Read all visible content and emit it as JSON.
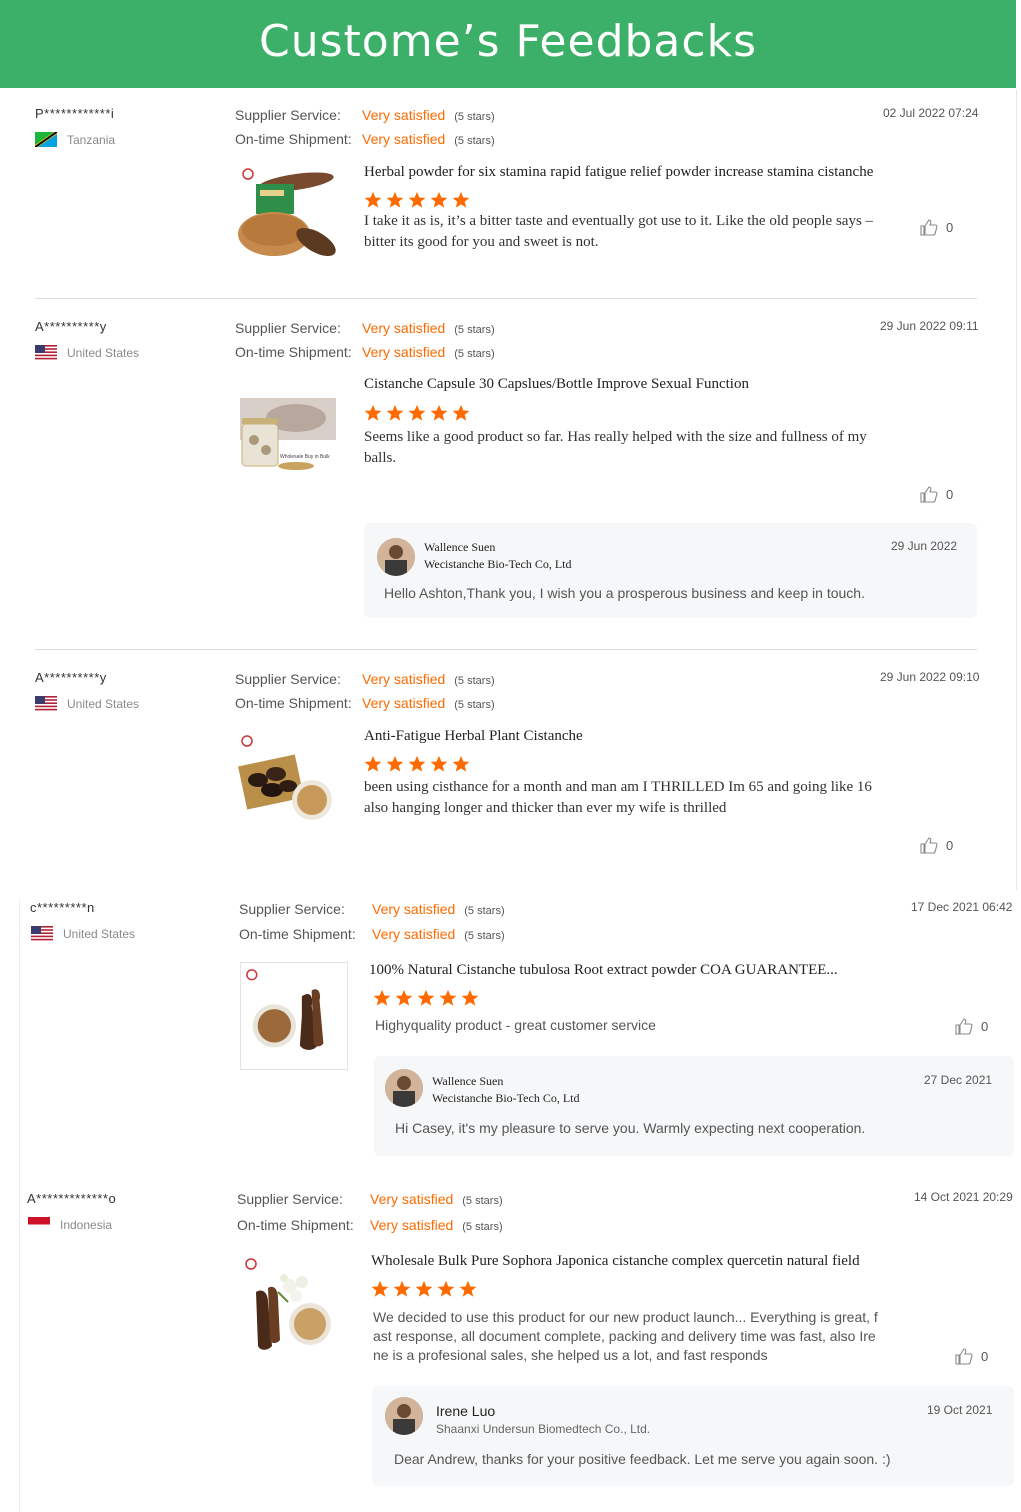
{
  "banner": {
    "title": "Custome’s Feedbacks"
  },
  "colors": {
    "banner": "#3cb068",
    "accent": "#ff6a00",
    "star": "#ff6a00"
  },
  "labels": {
    "supplier_service": "Supplier Service:",
    "ontime_shipment": "On-time Shipment:",
    "very_satisfied": "Very satisfied",
    "five_stars": "(5 stars)"
  },
  "reviews": [
    {
      "user": "P************i",
      "country": "Tanzania",
      "date": "02 Jul 2022 07:24",
      "product_title": "Herbal powder for six stamina rapid fatigue relief powder increase stamina cistanche",
      "product_image": "cistanche-powder-box-image",
      "stars": 5,
      "text_lines": [
        "I take it as is, it’s a bitter taste and eventually got use to it. Like the old people says –",
        "bitter its good for you and sweet is not."
      ],
      "likes": "0"
    },
    {
      "user": "A**********y",
      "country": "United States",
      "date": "29 Jun 2022 09:11",
      "product_title": "Cistanche Capsule 30 Capslues/Bottle Improve Sexual Function",
      "product_image": "capsule-bottle-image",
      "stars": 5,
      "text_lines": [
        "Seems like a good product so far. Has really helped with the size and fullness of my",
        "balls."
      ],
      "likes": "0",
      "reply": {
        "name": "Wallence Suen",
        "company": "Wecistanche Bio-Tech Co, Ltd",
        "date": "29 Jun 2022",
        "text": "Hello Ashton,Thank you, I wish you a prosperous business and keep in touch."
      }
    },
    {
      "user": "A**********y",
      "country": "United States",
      "date": "29 Jun 2022 09:10",
      "product_title": "Anti-Fatigue Herbal Plant Cistanche",
      "product_image": "dried-cistanche-slices-image",
      "stars": 5,
      "text_lines": [
        "been using cisthance for a month and man am I THRILLED Im 65 and going like 16",
        "also hanging longer and thicker than ever my wife is thrilled"
      ],
      "likes": "0"
    },
    {
      "user": "c*********n",
      "country": "United States",
      "date": "17 Dec 2021 06:42",
      "product_title": "100% Natural Cistanche tubulosa Root extract powder COA GUARANTEE...",
      "product_image": "cistanche-root-powder-image",
      "stars": 5,
      "text_lines": [
        "Highyquality product - great customer service"
      ],
      "likes": "0",
      "reply": {
        "name": "Wallence Suen",
        "company": "Wecistanche Bio-Tech Co, Ltd",
        "date": "27 Dec 2021",
        "text": "Hi Casey, it's my pleasure to serve you. Warmly expecting next cooperation."
      }
    },
    {
      "user": "A*************o",
      "country": "Indonesia",
      "date": "14 Oct 2021 20:29",
      "product_title": "Wholesale Bulk Pure Sophora Japonica cistanche complex quercetin natural field",
      "product_image": "sophora-flowers-powder-image",
      "stars": 5,
      "text_lines": [
        "We decided to use this product for our new product launch... Everything is great, f",
        "ast response, all document complete, packing and delivery time was fast, also Ire",
        "ne is a profesional sales, she helped us a lot, and fast responds"
      ],
      "likes": "0",
      "reply": {
        "name": "Irene Luo",
        "company": "Shaanxi Undersun Biomedtech Co., Ltd.",
        "date": "19 Oct 2021",
        "text": "Dear Andrew, thanks for your positive feedback. Let me serve you again soon. :)"
      }
    }
  ]
}
